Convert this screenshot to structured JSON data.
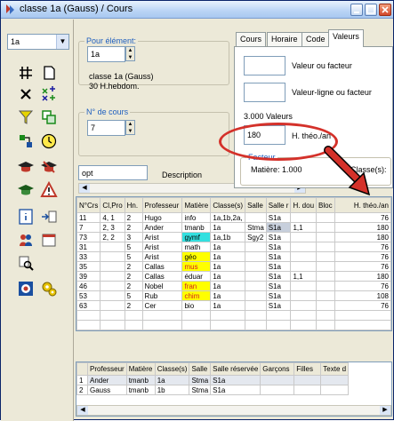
{
  "window": {
    "title": "classe 1a (Gauss) / Cours"
  },
  "left": {
    "class_select": "1a",
    "pour_element": {
      "title": "Pour élément:",
      "value": "1a",
      "info1": "classe 1a (Gauss)",
      "info2": "30 H.hebdom."
    },
    "no_cours": {
      "title": "N° de cours",
      "value": "7"
    },
    "opt_value": "opt",
    "description_label": "Description"
  },
  "tabs": {
    "items": [
      "Cours",
      "Horaire",
      "Code",
      "Valeurs"
    ],
    "active": "Valeurs",
    "valeur_facteur": "Valeur ou facteur",
    "valeur_ligne": "Valeur-ligne ou facteur",
    "total_valeurs": "3.000 Valeurs",
    "h_theo_value": "180",
    "h_theo_label": "H. théo./an",
    "facteur_title": "Facteur",
    "matiere_factor": "Matière: 1.000",
    "classes_label": "Classe(s):"
  },
  "grid": {
    "columns": [
      "N°Crs",
      "Cl,Pro",
      "Hn.",
      "Professeur",
      "Matière",
      "Classe(s)",
      "Salle",
      "Salle r",
      "H. dou",
      "Bloc",
      "H. théo./an"
    ],
    "rows": [
      [
        "11",
        "4, 1",
        "2",
        "Hugo",
        "info",
        "1a,1b,2a,",
        "",
        "S1a",
        "",
        "",
        "76"
      ],
      [
        "7",
        "2, 3",
        "2",
        "Ander",
        "tmanb",
        "1a",
        "Stma",
        "S1a",
        "1,1",
        "",
        "180"
      ],
      [
        "73",
        "2, 2",
        "3",
        "Arist",
        "gymf",
        "1a,1b",
        "Sgy2",
        "S1a",
        "",
        "",
        "180"
      ],
      [
        "31",
        "",
        "5",
        "Arist",
        "math",
        "1a",
        "",
        "S1a",
        "",
        "",
        "76"
      ],
      [
        "33",
        "",
        "5",
        "Arist",
        "géo",
        "1a",
        "",
        "S1a",
        "",
        "",
        "76"
      ],
      [
        "35",
        "",
        "2",
        "Callas",
        "mus",
        "1a",
        "",
        "S1a",
        "",
        "",
        "76"
      ],
      [
        "39",
        "",
        "2",
        "Callas",
        "éduar",
        "1a",
        "",
        "S1a",
        "1,1",
        "",
        "180"
      ],
      [
        "46",
        "",
        "2",
        "Nobel",
        "fran",
        "1a",
        "",
        "S1a",
        "",
        "",
        "76"
      ],
      [
        "53",
        "",
        "5",
        "Rub",
        "chim",
        "1a",
        "",
        "S1a",
        "",
        "",
        "108"
      ],
      [
        "63",
        "",
        "2",
        "Cer",
        "bio",
        "1a",
        "",
        "S1a",
        "",
        "",
        "76"
      ]
    ],
    "highlight_colors": {
      "gymf": "#33e0e0",
      "géo": "#ffff00",
      "mus": "#ffff00",
      "fran": "#ffff00",
      "chim": "#ffff00"
    }
  },
  "grid2": {
    "columns": [
      "",
      "Professeur",
      "Matière",
      "Classe(s)",
      "Salle",
      "Salle réservée",
      "Garçons",
      "Filles",
      "Texte d"
    ],
    "rows": [
      [
        "1",
        "Ander",
        "tmanb",
        "1a",
        "Stma",
        "S1a",
        "",
        "",
        ""
      ],
      [
        "2",
        "Gauss",
        "tmanb",
        "1b",
        "Stma",
        "S1a",
        "",
        "",
        ""
      ]
    ]
  },
  "colors": {
    "accent": "#d4312a",
    "titlebar": "#b9d4f5",
    "group_title": "#1f5fbf"
  }
}
